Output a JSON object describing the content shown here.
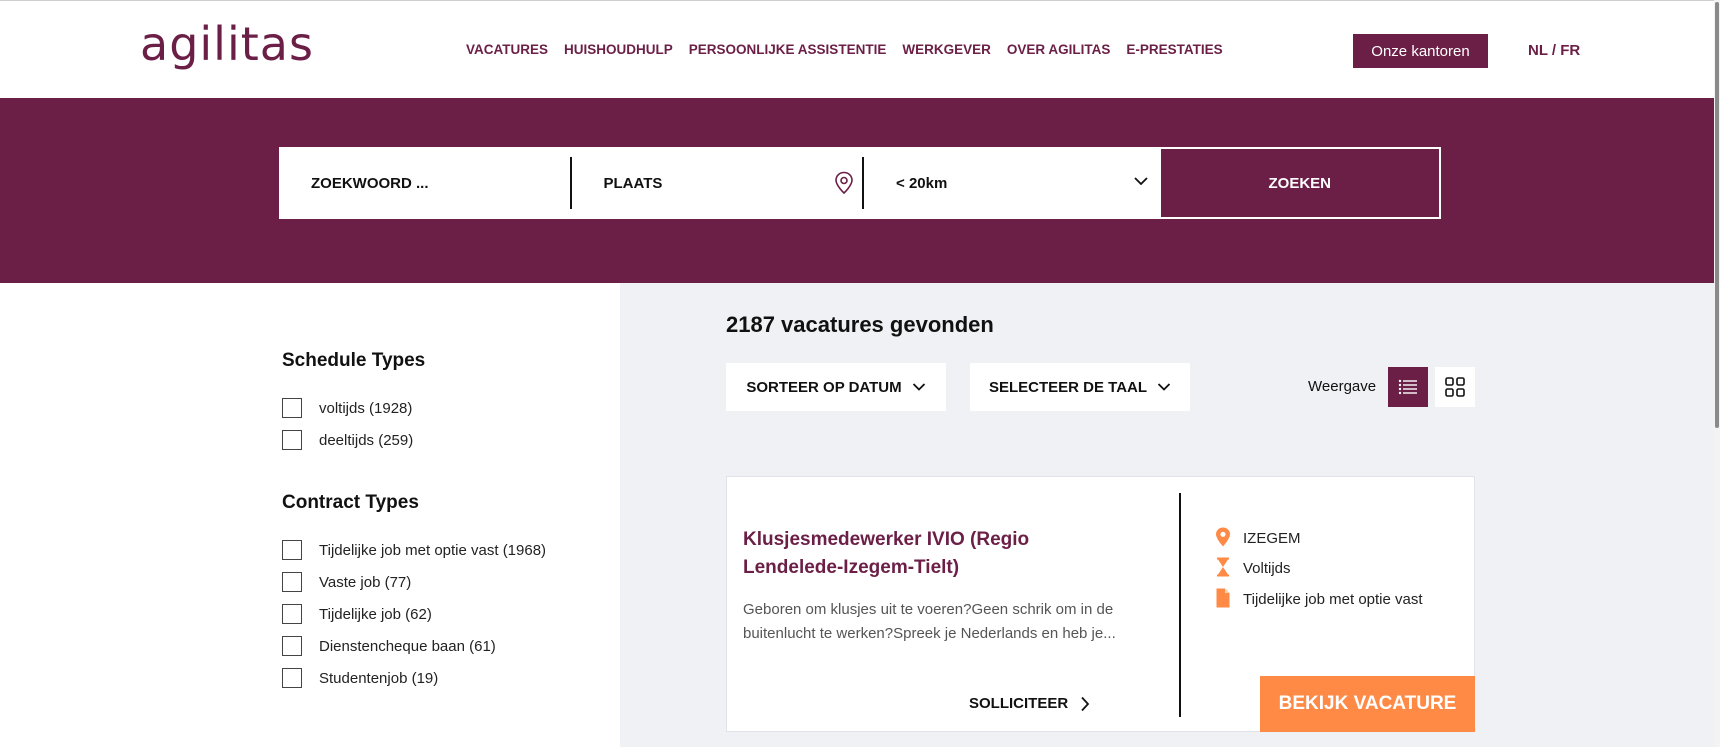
{
  "header": {
    "logo": "agilitas",
    "nav": [
      "VACATURES",
      "HUISHOUDHULP",
      "PERSOONLIJKE ASSISTENTIE",
      "WERKGEVER",
      "OVER AGILITAS",
      "E-PRESTATIES"
    ],
    "offices_button": "Onze kantoren",
    "language_switch": "NL / FR"
  },
  "search": {
    "keyword_placeholder": "ZOEKWOORD ...",
    "place_placeholder": "PLAATS",
    "distance_value": "< 20km",
    "submit_label": "ZOEKEN"
  },
  "filters": [
    {
      "title": "Schedule Types",
      "options": [
        "voltijds (1928)",
        "deeltijds (259)"
      ]
    },
    {
      "title": "Contract Types",
      "options": [
        "Tijdelijke job met optie vast (1968)",
        "Vaste job (77)",
        "Tijdelijke job (62)",
        "Dienstencheque baan (61)",
        "Studentenjob (19)"
      ]
    }
  ],
  "results": {
    "count_text": "2187 vacatures gevonden",
    "sort_label": "SORTEER OP DATUM",
    "language_label": "SELECTEER DE TAAL",
    "view_label": "Weergave"
  },
  "job": {
    "title": "Klusjesmedewerker IVIO (Regio Lendelede-Izegem-Tielt)",
    "description": "Geboren om klusjes uit te voeren?Geen schrik om in de buitenlucht te werken?Spreek je Nederlands en heb je...",
    "location": "IZEGEM",
    "schedule": "Voltijds",
    "contract": "Tijdelijke job met optie vast",
    "apply_label": "SOLLICITEER",
    "view_label": "BEKIJK VACATURE"
  },
  "colors": {
    "brand": "#6b1f46",
    "accent": "#ff8a46",
    "content_bg": "#f0f1f5"
  },
  "icons": {
    "location": "pin-icon",
    "schedule": "hourglass-icon",
    "contract": "document-icon"
  }
}
